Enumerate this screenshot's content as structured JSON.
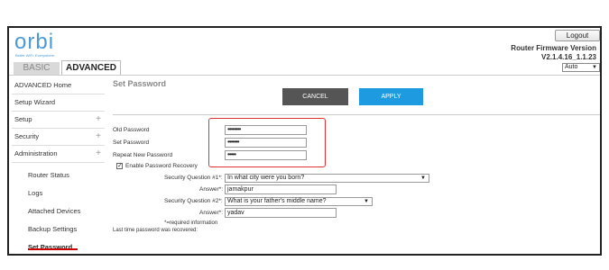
{
  "header": {
    "logo_text": "orbi",
    "logo_tagline": "Better WiFi. Everywhere.",
    "logout_label": "Logout",
    "firmware_title": "Router Firmware Version",
    "firmware_version": "V2.1.4.16_1.1.23",
    "language_value": "Auto"
  },
  "tabs": [
    {
      "label": "BASIC",
      "active": false
    },
    {
      "label": "ADVANCED",
      "active": true
    }
  ],
  "sidebar": {
    "items": [
      {
        "label": "ADVANCED Home"
      },
      {
        "label": "Setup Wizard"
      },
      {
        "label": "Setup",
        "expander": "+"
      },
      {
        "label": "Security",
        "expander": "+"
      },
      {
        "label": "Administration",
        "expander": "+"
      }
    ],
    "sub_items": [
      {
        "label": "Router Status"
      },
      {
        "label": "Logs"
      },
      {
        "label": "Attached Devices"
      },
      {
        "label": "Backup Settings"
      },
      {
        "label": "Set Password",
        "active": true
      }
    ]
  },
  "main": {
    "title": "Set Password",
    "cancel_label": "CANCEL",
    "apply_label": "APPLY",
    "old_password_label": "Old Password",
    "old_password_value": "••••••••",
    "set_password_label": "Set Password",
    "set_password_value": "•••••••",
    "repeat_password_label": "Repeat New Password",
    "repeat_password_value": "•••••",
    "enable_recovery_label": "Enable Password Recovery",
    "enable_recovery_checked": true,
    "q1_label": "Security Question #1*:",
    "q1_value": "In what city were you born?",
    "answer1_label": "Answer*:",
    "answer1_value": "jamakpur",
    "q2_label": "Security Question #2*:",
    "q2_value": "What is your father's middle name?",
    "answer2_label": "Answer*:",
    "answer2_value": "yadav",
    "required_note": "*=required information",
    "last_recovered_label": "Last time password was recovered:"
  },
  "colors": {
    "brand": "#4a9ad8",
    "apply": "#1e9be0",
    "cancel": "#555555",
    "highlight": "#d33333"
  }
}
